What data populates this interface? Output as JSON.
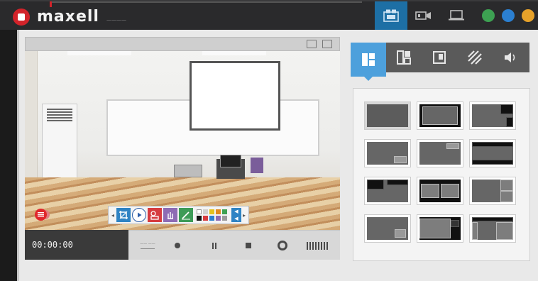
{
  "app": {
    "brand_name": "maxell",
    "brand_sub": "————"
  },
  "top_icons": [
    {
      "name": "camera-layout-icon",
      "active": true
    },
    {
      "name": "video-camera-icon",
      "active": false
    },
    {
      "name": "laptop-icon",
      "active": false
    }
  ],
  "status_dots": [
    {
      "name": "status-dot-green",
      "color": "#3da152"
    },
    {
      "name": "status-dot-blue",
      "color": "#2b7fd0"
    },
    {
      "name": "status-dot-orange",
      "color": "#e7a22a"
    }
  ],
  "controls": {
    "timecode": "00:00:00",
    "label_text": "—— ——"
  },
  "layout_tabs": [
    {
      "name": "tab-layouts",
      "icon": "layout-grid-icon",
      "active": true
    },
    {
      "name": "tab-split-layouts",
      "icon": "split-layout-icon",
      "active": false
    },
    {
      "name": "tab-single-view",
      "icon": "single-view-icon",
      "active": false
    },
    {
      "name": "tab-effects",
      "icon": "stripes-icon",
      "active": false
    },
    {
      "name": "tab-audio",
      "icon": "speaker-icon",
      "active": false
    }
  ],
  "layouts": [
    {
      "id": "single",
      "selected": true
    },
    {
      "id": "single-dark",
      "selected": false
    },
    {
      "id": "top-right-pip",
      "selected": false
    },
    {
      "id": "bottom-right-pip",
      "selected": false
    },
    {
      "id": "top-right-small",
      "selected": false
    },
    {
      "id": "top-bottom-bars",
      "selected": false
    },
    {
      "id": "top-left-dark",
      "selected": false
    },
    {
      "id": "side-by-side",
      "selected": false
    },
    {
      "id": "right-column",
      "selected": false
    },
    {
      "id": "bottom-right-small",
      "selected": false
    },
    {
      "id": "big-with-small-dark",
      "selected": false
    },
    {
      "id": "three-panel",
      "selected": false
    }
  ],
  "palette": [
    "#ffffff",
    "#d0d0d0",
    "#e3c31f",
    "#e08a1f",
    "#3da152",
    "#111111",
    "#d63b3f",
    "#2b7fd0",
    "#8d6bb4",
    "#9a9a9a"
  ]
}
